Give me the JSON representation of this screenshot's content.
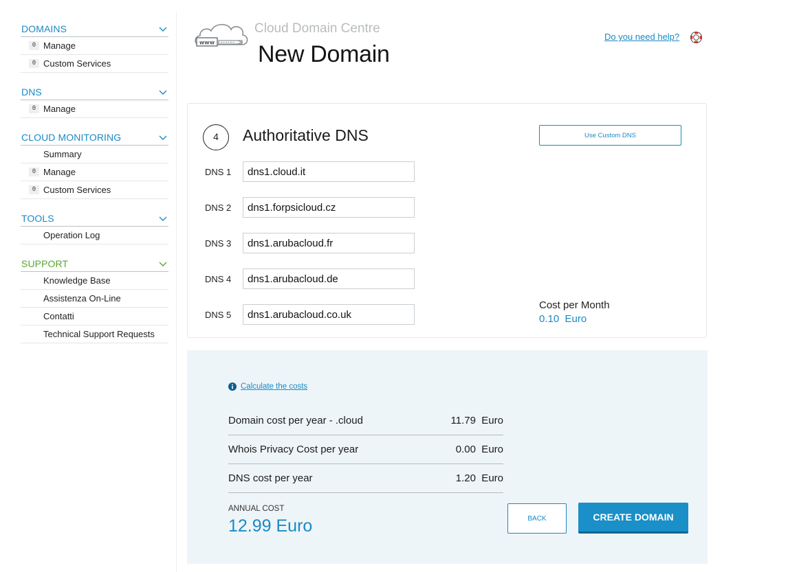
{
  "colors": {
    "accent": "#1a89c4",
    "support": "#5aa532",
    "panel": "#eef5f8"
  },
  "sidebar": {
    "sections": [
      {
        "title": "DOMAINS",
        "items": [
          {
            "count": "0",
            "label": "Manage"
          },
          {
            "count": "0",
            "label": "Custom Services"
          }
        ]
      },
      {
        "title": "DNS",
        "items": [
          {
            "count": "0",
            "label": "Manage"
          }
        ]
      },
      {
        "title": "CLOUD MONITORING",
        "items": [
          {
            "label": "Summary"
          },
          {
            "count": "0",
            "label": "Manage"
          },
          {
            "count": "0",
            "label": "Custom Services"
          }
        ]
      },
      {
        "title": "TOOLS",
        "items": [
          {
            "label": "Operation Log"
          }
        ]
      },
      {
        "title": "SUPPORT",
        "items": [
          {
            "label": "Knowledge Base"
          },
          {
            "label": "Assistenza On-Line"
          },
          {
            "label": "Contatti"
          },
          {
            "label": "Technical Support Requests"
          }
        ]
      }
    ]
  },
  "header": {
    "logo_icon": "cloud-www-icon",
    "logo_text": "www",
    "app_name": "Cloud Domain Centre",
    "page_title": "New Domain",
    "help_text": "Do you need help?",
    "help_icon": "lifebuoy-icon"
  },
  "dns": {
    "step": "4",
    "title": "Authoritative DNS",
    "custom_button": "Use Custom DNS",
    "rows": [
      {
        "label": "DNS 1",
        "value": "dns1.cloud.it"
      },
      {
        "label": "DNS 2",
        "value": "dns1.forpsicloud.cz"
      },
      {
        "label": "DNS 3",
        "value": "dns1.arubacloud.fr"
      },
      {
        "label": "DNS 4",
        "value": "dns1.arubacloud.de"
      },
      {
        "label": "DNS 5",
        "value": "dns1.arubacloud.co.uk"
      }
    ],
    "cost_per_month_label": "Cost per Month",
    "cost_per_month_value": "0.10  Euro"
  },
  "costs": {
    "info_icon": "info-icon",
    "calc_link": "Calculate the costs",
    "rows": [
      {
        "label": "Domain cost per year - .cloud",
        "amount": "11.79  Euro"
      },
      {
        "label": "Whois Privacy Cost per year",
        "amount": "0.00  Euro"
      },
      {
        "label": "DNS cost per year",
        "amount": "1.20  Euro"
      }
    ],
    "annual_label": "ANNUAL COST",
    "annual_value": "12.99 Euro",
    "back_button": "BACK",
    "create_button": "CREATE DOMAIN"
  }
}
